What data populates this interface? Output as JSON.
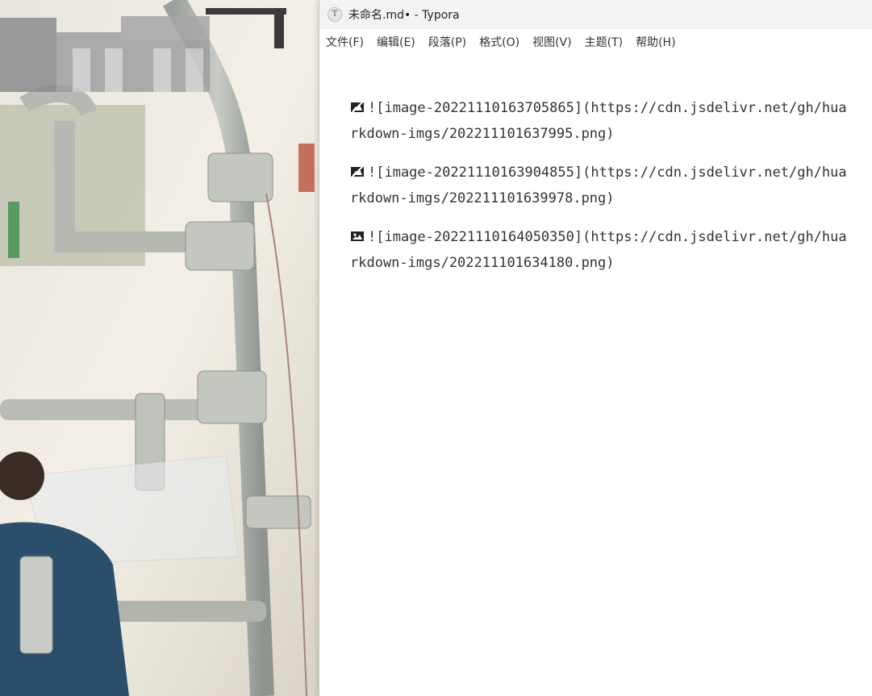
{
  "window": {
    "title": "未命名.md• - Typora",
    "app_icon_letter": "T"
  },
  "menu": {
    "items": [
      {
        "label": "文件(F)"
      },
      {
        "label": "编辑(E)"
      },
      {
        "label": "段落(P)"
      },
      {
        "label": "格式(O)"
      },
      {
        "label": "视图(V)"
      },
      {
        "label": "主题(T)"
      },
      {
        "label": "帮助(H)"
      }
    ]
  },
  "editor": {
    "images": [
      {
        "icon": "broken-image-icon",
        "line1": "![image-20221110163705865](https://cdn.jsdelivr.net/gh/hua",
        "line2": "rkdown-imgs/202211101637995.png)"
      },
      {
        "icon": "broken-image-icon",
        "line1": "![image-20221110163904855](https://cdn.jsdelivr.net/gh/hua",
        "line2": "rkdown-imgs/202211101639978.png)"
      },
      {
        "icon": "image-icon",
        "line1": "![image-20221110164050350](https://cdn.jsdelivr.net/gh/hua",
        "line2": "rkdown-imgs/202211101634180.png)"
      }
    ]
  }
}
